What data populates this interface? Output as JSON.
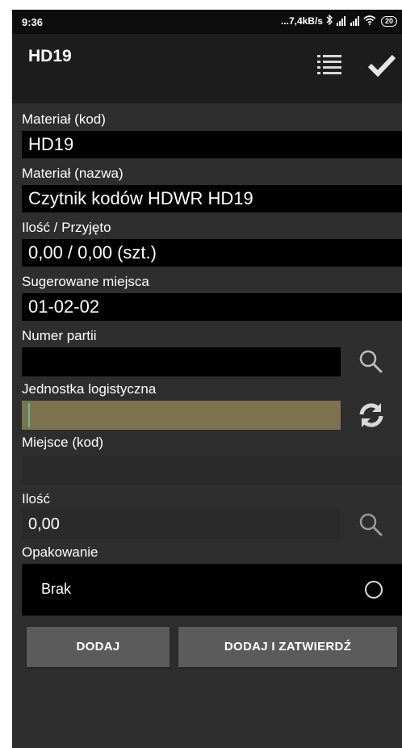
{
  "status_bar": {
    "time": "9:36",
    "network": "...7,4kB/s",
    "battery": "20"
  },
  "app_bar": {
    "title": "HD19",
    "list_icon": "list-icon",
    "confirm_icon": "check-icon"
  },
  "fields": {
    "material_code": {
      "label": "Materiał (kod)",
      "value": "HD19"
    },
    "material_name": {
      "label": "Materiał (nazwa)",
      "value": "Czytnik kodów HDWR HD19"
    },
    "quantity_received": {
      "label": "Ilość / Przyjęto",
      "value": "0,00 / 0,00 (szt.)"
    },
    "suggested_locations": {
      "label": "Sugerowane miejsca",
      "value": "01-02-02"
    },
    "batch_number": {
      "label": "Numer partii",
      "value": ""
    },
    "logistic_unit": {
      "label": "Jednostka logistyczna",
      "value": ""
    },
    "location_code": {
      "label": "Miejsce (kod)",
      "value": ""
    },
    "quantity": {
      "label": "Ilość",
      "value": "0,00"
    },
    "packaging": {
      "label": "Opakowanie",
      "value": "Brak"
    }
  },
  "buttons": {
    "add": "DODAJ",
    "add_confirm": "DODAJ I ZATWIERDŹ"
  },
  "colors": {
    "background": "#2e2e2e",
    "app_bar": "#1d1d1d",
    "value_box": "#000000",
    "logistic_unit_field": "#7d7351",
    "cursor": "#4fc3a1",
    "button": "#5b5b5b"
  }
}
